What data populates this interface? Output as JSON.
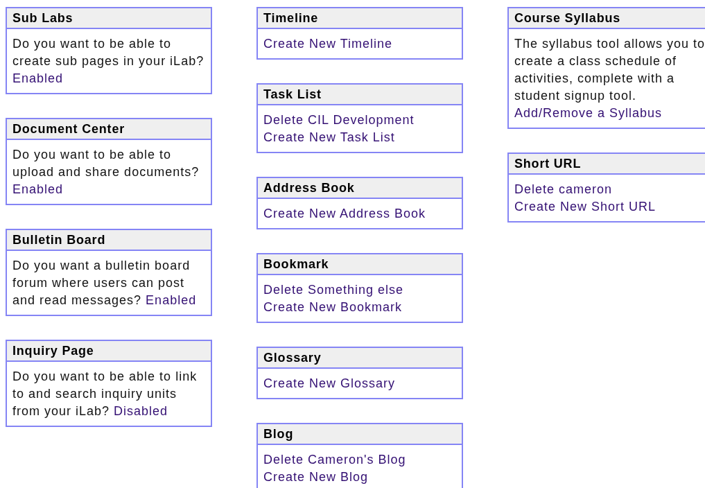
{
  "columns": [
    [
      {
        "title": "Sub Labs",
        "description": "Do you want to be able to create sub pages in your iLab?",
        "links": [
          "Enabled"
        ]
      },
      {
        "title": "Document Center",
        "description": "Do you want to be able to upload and share documents?",
        "links": [
          "Enabled"
        ]
      },
      {
        "title": "Bulletin Board",
        "description": "Do you want a bulletin board forum where users can post and read messages?",
        "links": [
          "Enabled"
        ]
      },
      {
        "title": "Inquiry Page",
        "description": "Do you want to be able to link to and search inquiry units from your iLab?",
        "links": [
          "Disabled"
        ]
      }
    ],
    [
      {
        "title": "Timeline",
        "links": [
          "Create New Timeline"
        ]
      },
      {
        "title": "Task List",
        "links": [
          "Delete CIL Development",
          "Create New Task List"
        ]
      },
      {
        "title": "Address Book",
        "links": [
          "Create New Address Book"
        ]
      },
      {
        "title": "Bookmark",
        "links": [
          "Delete Something else",
          "Create New Bookmark"
        ]
      },
      {
        "title": "Glossary",
        "links": [
          "Create New Glossary"
        ]
      },
      {
        "title": "Blog",
        "links": [
          "Delete Cameron's Blog",
          "Create New Blog"
        ]
      }
    ],
    [
      {
        "title": "Course Syllabus",
        "description": "The syllabus tool allows you to create a class schedule of activities, complete with a student signup tool.",
        "links": [
          "Add/Remove a Syllabus"
        ]
      },
      {
        "title": "Short URL",
        "links": [
          "Delete cameron",
          "Create New Short URL"
        ]
      }
    ]
  ]
}
